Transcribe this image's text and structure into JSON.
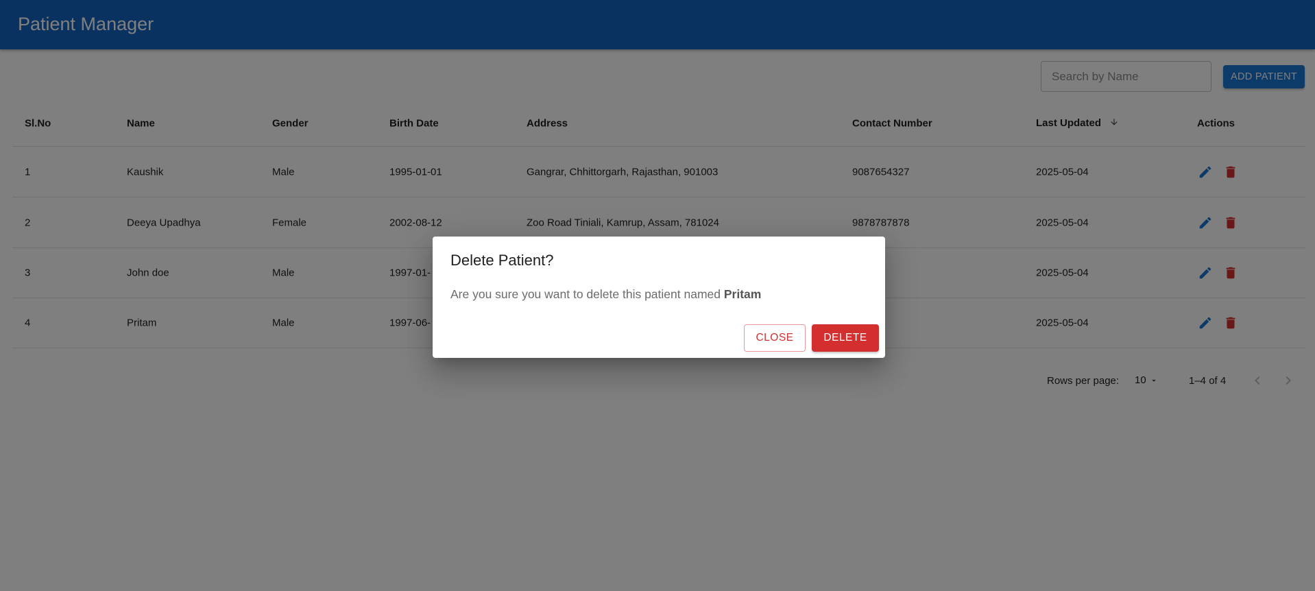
{
  "app": {
    "title": "Patient Manager"
  },
  "toolbar": {
    "search_placeholder": "Search by Name",
    "add_label": "ADD PATIENT"
  },
  "table": {
    "columns": {
      "sl": "Sl.No",
      "name": "Name",
      "gender": "Gender",
      "birth": "Birth Date",
      "address": "Address",
      "contact": "Contact Number",
      "updated": "Last Updated",
      "actions": "Actions"
    },
    "sort": {
      "column": "Last Updated",
      "direction": "desc"
    },
    "rows": [
      {
        "sl": "1",
        "name": "Kaushik",
        "gender": "Male",
        "birth": "1995-01-01",
        "address": "Gangrar, Chhittorgarh, Rajasthan, 901003",
        "contact": "9087654327",
        "updated": "2025-05-04"
      },
      {
        "sl": "2",
        "name": "Deeya Upadhya",
        "gender": "Female",
        "birth": "2002-08-12",
        "address": "Zoo Road Tiniali, Kamrup, Assam, 781024",
        "contact": "9878787878",
        "updated": "2025-05-04"
      },
      {
        "sl": "3",
        "name": "John doe",
        "gender": "Male",
        "birth": "1997-01-",
        "address": "",
        "contact": "75645",
        "updated": "2025-05-04"
      },
      {
        "sl": "4",
        "name": "Pritam",
        "gender": "Male",
        "birth": "1997-06-",
        "address": "",
        "contact": "64534",
        "updated": "2025-05-04"
      }
    ]
  },
  "pagination": {
    "rows_label": "Rows per page:",
    "rows_value": "10",
    "range": "1–4 of 4"
  },
  "dialog": {
    "title": "Delete Patient?",
    "message": "Are you sure you want to delete this patient named ",
    "patient_name": "Pritam",
    "close_label": "CLOSE",
    "delete_label": "DELETE"
  },
  "colors": {
    "primary": "#1976d2",
    "appbar": "#1565c0",
    "danger": "#d32f2f"
  },
  "icons": {
    "edit": "pencil-icon",
    "delete": "trash-icon",
    "sort": "arrow-down-icon"
  }
}
